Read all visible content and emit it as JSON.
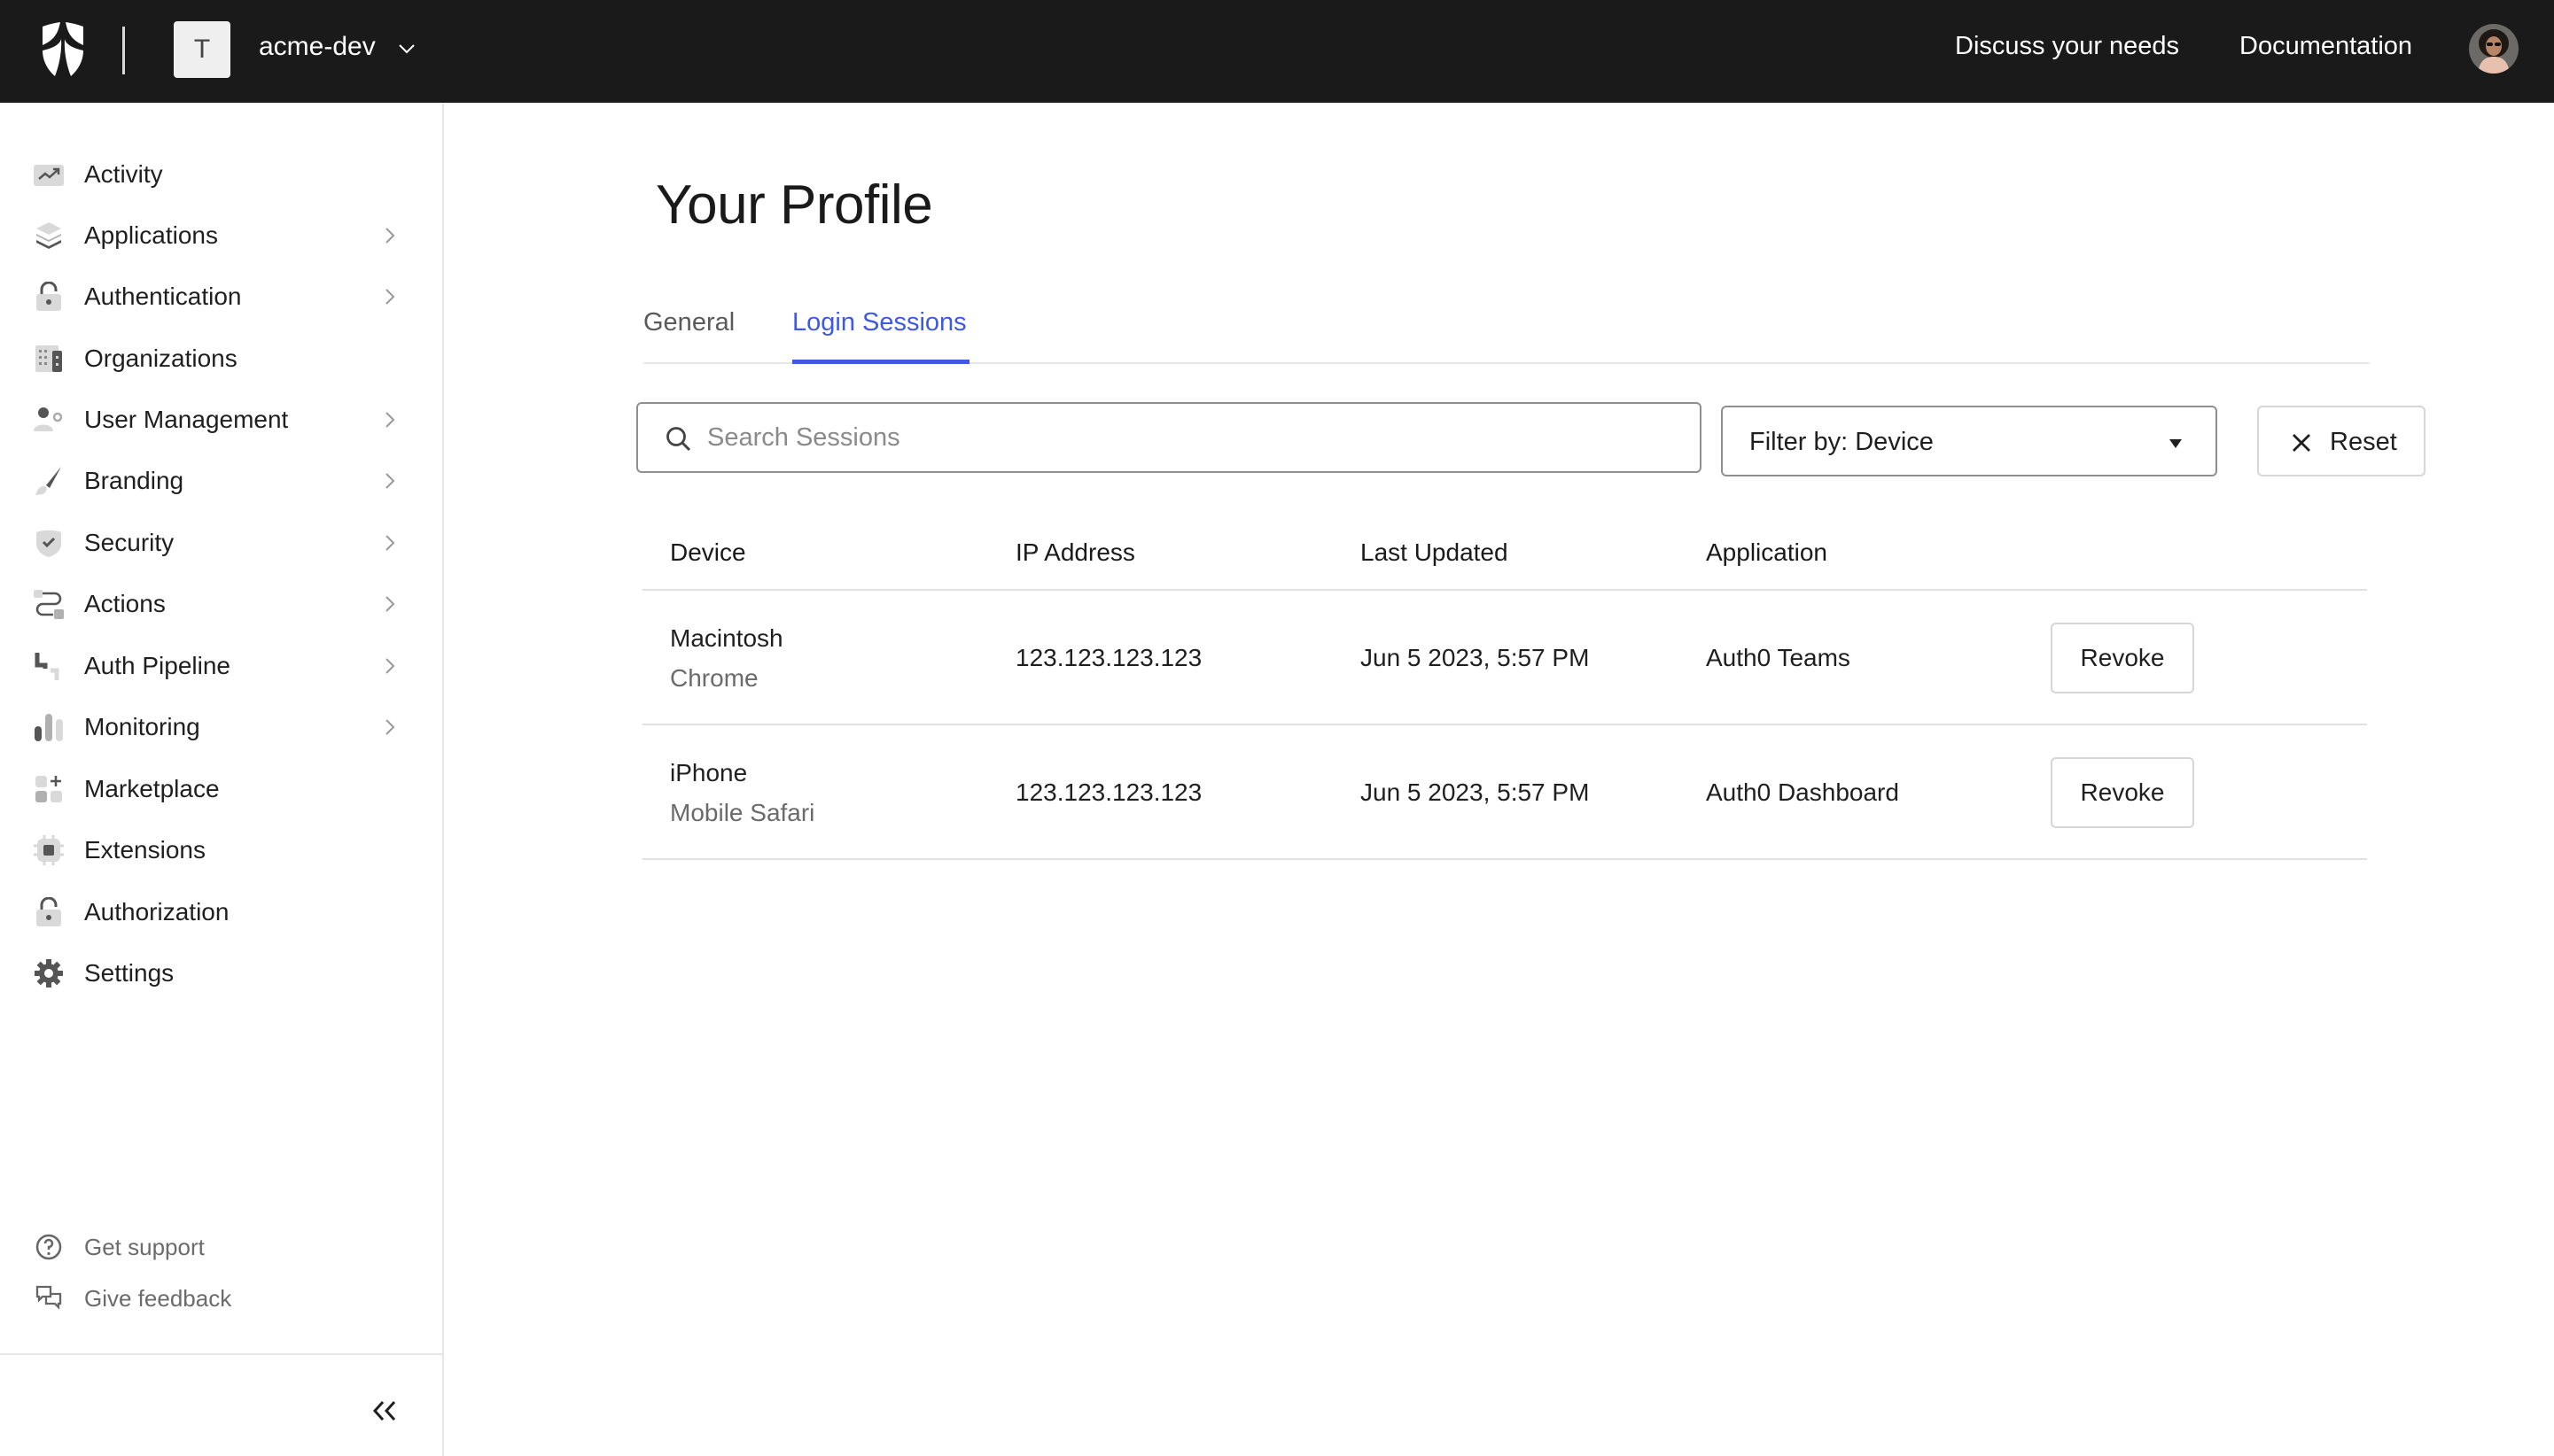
{
  "header": {
    "tenant_initial": "T",
    "tenant_name": "acme-dev",
    "links": [
      "Discuss your needs",
      "Documentation"
    ]
  },
  "sidebar": {
    "items": [
      {
        "label": "Activity",
        "icon": "activity-icon",
        "has_children": false
      },
      {
        "label": "Applications",
        "icon": "layers-icon",
        "has_children": true
      },
      {
        "label": "Authentication",
        "icon": "unlocked-padlock-icon",
        "has_children": true
      },
      {
        "label": "Organizations",
        "icon": "building-icon",
        "has_children": false
      },
      {
        "label": "User Management",
        "icon": "user-gear-icon",
        "has_children": true
      },
      {
        "label": "Branding",
        "icon": "paintbrush-icon",
        "has_children": true
      },
      {
        "label": "Security",
        "icon": "shield-check-icon",
        "has_children": true
      },
      {
        "label": "Actions",
        "icon": "flow-icon",
        "has_children": true
      },
      {
        "label": "Auth Pipeline",
        "icon": "pipe-icon",
        "has_children": true
      },
      {
        "label": "Monitoring",
        "icon": "bar-chart-icon",
        "has_children": true
      },
      {
        "label": "Marketplace",
        "icon": "grid-plus-icon",
        "has_children": false
      },
      {
        "label": "Extensions",
        "icon": "chip-icon",
        "has_children": false
      },
      {
        "label": "Authorization",
        "icon": "unlocked-padlock-icon",
        "has_children": false
      },
      {
        "label": "Settings",
        "icon": "gear-icon",
        "has_children": false
      }
    ],
    "support": [
      {
        "label": "Get support",
        "icon": "question-circle-icon"
      },
      {
        "label": "Give feedback",
        "icon": "chat-bubbles-icon"
      }
    ]
  },
  "main": {
    "title": "Your Profile",
    "tabs": [
      {
        "label": "General",
        "active": false
      },
      {
        "label": "Login Sessions",
        "active": true
      }
    ],
    "search": {
      "placeholder": "Search Sessions",
      "value": ""
    },
    "filter": {
      "label": "Filter by: Device"
    },
    "reset_label": "Reset",
    "table": {
      "columns": [
        "Device",
        "IP Address",
        "Last Updated",
        "Application"
      ],
      "rows": [
        {
          "device": "Macintosh",
          "browser": "Chrome",
          "ip": "123.123.123.123",
          "updated": "Jun 5 2023, 5:57 PM",
          "application": "Auth0 Teams",
          "action": "Revoke"
        },
        {
          "device": "iPhone",
          "browser": "Mobile Safari",
          "ip": "123.123.123.123",
          "updated": "Jun 5 2023, 5:57 PM",
          "application": "Auth0 Dashboard",
          "action": "Revoke"
        }
      ]
    }
  },
  "colors": {
    "header_bg": "#1a1a1a",
    "accent": "#3f59e4",
    "border": "#e6e6e6"
  }
}
